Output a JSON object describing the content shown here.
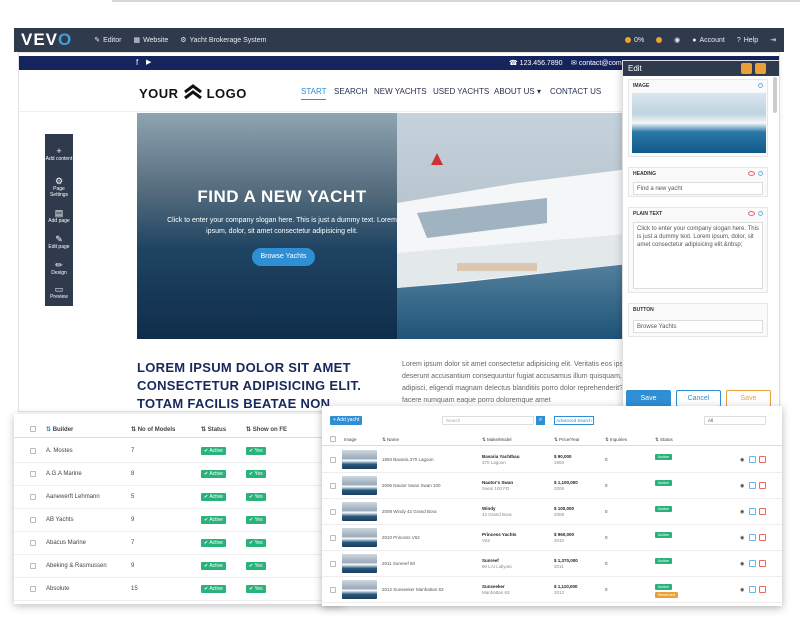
{
  "topbar": {
    "logo_main": "VEV",
    "logo_accent": "O",
    "editor": "Editor",
    "website": "Website",
    "site_name": "Yacht Brokerage System",
    "progress": "0%",
    "account": "Account",
    "help": "Help"
  },
  "site": {
    "phone": "123.456.7890",
    "email": "contact@com",
    "logo_a": "YOUR",
    "logo_b": "LOGO",
    "menu": [
      "START",
      "SEARCH",
      "NEW YACHTS",
      "USED YACHTS",
      "ABOUT US",
      "CONTACT US"
    ],
    "hero_title": "FIND A NEW YACHT",
    "hero_text": "Click to enter your company slogan here. This is just a dummy text. Lorem ipsum, dolor, sit amet consectetur adipisicing elit.",
    "hero_button": "Browse Yachts",
    "lorem_heading": "LOREM IPSUM DOLOR SIT AMET CONSECTETUR ADIPISICING ELIT. TOTAM FACILIS BEATAE NON",
    "lorem_text": "Lorem ipsum dolor sit amet consectetur adipisicing elit. Veritatis eos ipsam deserunt accusantium consequuntur fugiat accusamus illum quisquam, adipisci, eligendi magnam delectus blanditiis porro dolor reprehenderit? Ea facere numquam eaque porro doloremque amet"
  },
  "toolbar": [
    {
      "icon": "+",
      "label": "Add content"
    },
    {
      "icon": "⚙",
      "label": "Page Settings"
    },
    {
      "icon": "▤",
      "label": "Add page"
    },
    {
      "icon": "✎",
      "label": "Edit page"
    },
    {
      "icon": "✏",
      "label": "Design"
    },
    {
      "icon": "▭",
      "label": "Preview"
    }
  ],
  "edit": {
    "title": "Edit",
    "image_label": "IMAGE",
    "heading_label": "HEADING",
    "heading_value": "Find a new yacht",
    "plain_label": "PLAIN TEXT",
    "plain_value": "Click to enter your company slogan here. This is just a dummy text. Lorem ipsum, dolor, sit amet consectetur adipisicing elit.&nbsp;",
    "button_label": "BUTTON",
    "button_value": "Browse Yachts",
    "save": "Save",
    "cancel": "Cancel",
    "save2": "Save"
  },
  "builders": {
    "headers": [
      "Builder",
      "No of Models",
      "Status",
      "Show on FE"
    ],
    "rows": [
      {
        "name": "A. Mostes",
        "models": "7",
        "status": "Active",
        "show": "Yes"
      },
      {
        "name": "A.G.A Marine",
        "models": "8",
        "status": "Active",
        "show": "Yes"
      },
      {
        "name": "Aanewerft Lehmann",
        "models": "5",
        "status": "Active",
        "show": "Yes"
      },
      {
        "name": "AB Yachts",
        "models": "9",
        "status": "Active",
        "show": "Yes"
      },
      {
        "name": "Abacus Marine",
        "models": "7",
        "status": "Active",
        "show": "Yes"
      },
      {
        "name": "Abeking & Rasmussen",
        "models": "9",
        "status": "Active",
        "show": "Yes"
      },
      {
        "name": "Absolute",
        "models": "15",
        "status": "Active",
        "show": "Yes"
      }
    ]
  },
  "yachts": {
    "add": "+ Add yacht",
    "search_placeholder": "Search",
    "advanced": "Advanced Search",
    "filter": "All",
    "headers": [
      "Image",
      "Name",
      "Make/Model",
      "Price/Year",
      "Inquiries",
      "Status"
    ],
    "rows": [
      {
        "name": "1993 Bavaria 370 Lagoon",
        "make": "Bavaria Yachtbau",
        "model": "370 Lagoon",
        "price": "$ 90,000",
        "year": "1993",
        "inq": "0",
        "status": "Active"
      },
      {
        "name": "2006 Nautor Swan Swan 100",
        "make": "Nautor's Swan",
        "model": "Swan 100 FD",
        "price": "$ 1,100,000",
        "year": "2006",
        "inq": "0",
        "status": "Active"
      },
      {
        "name": "2008 Windy 42 Grand Bora",
        "make": "Windy",
        "model": "42 Grand Bora",
        "price": "$ 100,000",
        "year": "2008",
        "inq": "0",
        "status": "Active"
      },
      {
        "name": "2010 Princess V62",
        "make": "Princess Yachts",
        "model": "V62",
        "price": "$ 960,000",
        "year": "2010",
        "inq": "0",
        "status": "Active"
      },
      {
        "name": "2011 Sunreef 60",
        "make": "Sunreef",
        "model": "60 LAI Lidiyoto",
        "price": "$ 1,370,000",
        "year": "2011",
        "inq": "0",
        "status": "Active"
      },
      {
        "name": "2012 Sunseeker Manhattan 63",
        "make": "Sunseeker",
        "model": "Manhattan 63",
        "price": "$ 1,110,000",
        "year": "2012",
        "inq": "0",
        "status": "Active",
        "extra": "Reserved"
      }
    ]
  },
  "colors": {
    "navy": "#15245c",
    "bar": "#2f3a4d",
    "accent": "#2f8fd5",
    "green": "#2ab27b",
    "orange": "#e8a037"
  }
}
